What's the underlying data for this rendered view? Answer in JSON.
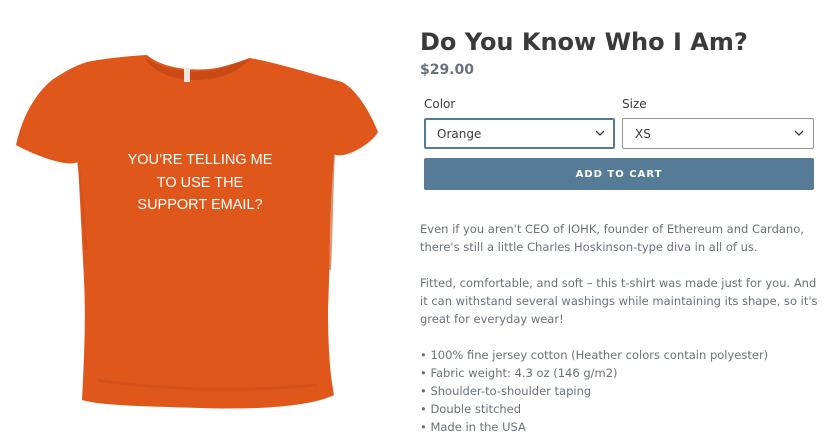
{
  "product": {
    "image_text_lines": [
      "YOU’RE TELLING ME",
      "TO USE THE",
      "SUPPORT EMAIL?"
    ],
    "shirt_color": "#e0571c",
    "title": "Do You Know Who I Am?",
    "price": "$29.00"
  },
  "options": {
    "color": {
      "label": "Color",
      "value": "Orange"
    },
    "size": {
      "label": "Size",
      "value": "XS"
    }
  },
  "add_to_cart": "ADD TO CART",
  "description": {
    "paragraph_1": "Even if you aren't CEO of IOHK, founder of Ethereum and Cardano, there's still a little Charles Hoskinson-type diva in all of us.",
    "paragraph_2": "Fitted, comfortable, and soft – this t-shirt was made just for you. And it can withstand several washings while maintaining its shape, so it's great for everyday wear!",
    "bullets": [
      "100% fine jersey cotton (Heather colors contain polyester)",
      "Fabric weight: 4.3 oz (146 g/m2)",
      "Shoulder-to-shoulder taping",
      "Double stitched",
      "Made in the USA"
    ]
  },
  "colors": {
    "accent": "#557b97",
    "price": "#69727b",
    "text": "#3a3a3a"
  }
}
